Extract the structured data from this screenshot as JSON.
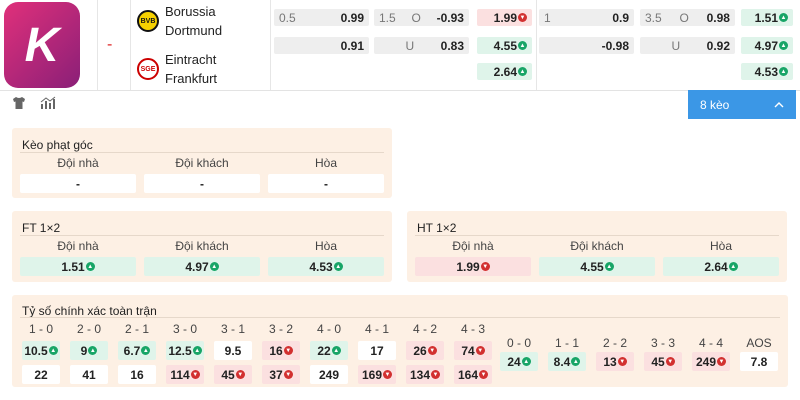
{
  "logo": {
    "letter": "K"
  },
  "match": {
    "dash": "-",
    "home": {
      "name1": "Borussia",
      "name2": "Dortmund",
      "crest": "BVB"
    },
    "away": {
      "name1": "Eintracht",
      "name2": "Frankfurt",
      "crest": "SGE"
    }
  },
  "odds": {
    "r1": [
      {
        "a": "0.5",
        "b": "0.99",
        "t": "n"
      },
      {
        "a": "1.5",
        "m": "O",
        "b": "-0.93",
        "t": "n"
      },
      {
        "b": "1.99",
        "t": "dn"
      },
      {
        "a": "1",
        "b": "0.9",
        "t": "n"
      },
      {
        "a": "3.5",
        "m": "O",
        "b": "0.98",
        "t": "n"
      },
      {
        "b": "1.51",
        "t": "up"
      }
    ],
    "r2": [
      {
        "a": "",
        "b": "0.91",
        "t": "n"
      },
      {
        "a": "",
        "m": "U",
        "b": "0.83",
        "t": "n"
      },
      {
        "b": "4.55",
        "t": "up"
      },
      {
        "a": "",
        "b": "-0.98",
        "t": "n"
      },
      {
        "a": "",
        "m": "U",
        "b": "0.92",
        "t": "n"
      },
      {
        "b": "4.97",
        "t": "up"
      }
    ],
    "r3": [
      {
        "b": "2.64",
        "t": "up"
      },
      {
        "b": "4.53",
        "t": "up"
      }
    ]
  },
  "toolbar": {
    "shirt_icon": "shirt-icon",
    "stats_icon": "stats-icon",
    "more_label": "8 kèo"
  },
  "corner": {
    "title": "Kèo phạt góc",
    "headers": [
      "Đội nhà",
      "Đội khách",
      "Hòa"
    ],
    "values": [
      "-",
      "-",
      "-"
    ]
  },
  "ft": {
    "title": "FT 1×2",
    "headers": [
      "Đội nhà",
      "Đội khách",
      "Hòa"
    ],
    "values": [
      {
        "v": "1.51",
        "t": "up"
      },
      {
        "v": "4.97",
        "t": "up"
      },
      {
        "v": "4.53",
        "t": "up"
      }
    ]
  },
  "ht": {
    "title": "HT 1×2",
    "headers": [
      "Đội nhà",
      "Đội khách",
      "Hòa"
    ],
    "values": [
      {
        "v": "1.99",
        "t": "dn"
      },
      {
        "v": "4.55",
        "t": "up"
      },
      {
        "v": "2.64",
        "t": "up"
      }
    ]
  },
  "exact": {
    "title": "Tỷ số chính xác toàn trận",
    "home_scores": [
      "1 - 0",
      "2 - 0",
      "2 - 1",
      "3 - 0",
      "3 - 1",
      "3 - 2",
      "4 - 0",
      "4 - 1",
      "4 - 2",
      "4 - 3"
    ],
    "home_row1": [
      {
        "v": "10.5",
        "t": "up"
      },
      {
        "v": "9",
        "t": "up"
      },
      {
        "v": "6.7",
        "t": "up"
      },
      {
        "v": "12.5",
        "t": "up"
      },
      {
        "v": "9.5",
        "t": "n"
      },
      {
        "v": "16",
        "t": "dn"
      },
      {
        "v": "22",
        "t": "up"
      },
      {
        "v": "17",
        "t": "n"
      },
      {
        "v": "26",
        "t": "dn"
      },
      {
        "v": "74",
        "t": "dn"
      }
    ],
    "home_row2": [
      {
        "v": "22",
        "t": "n"
      },
      {
        "v": "41",
        "t": "n"
      },
      {
        "v": "16",
        "t": "n"
      },
      {
        "v": "114",
        "t": "dn"
      },
      {
        "v": "45",
        "t": "dn"
      },
      {
        "v": "37",
        "t": "dn"
      },
      {
        "v": "249",
        "t": "n"
      },
      {
        "v": "169",
        "t": "dn"
      },
      {
        "v": "134",
        "t": "dn"
      },
      {
        "v": "164",
        "t": "dn"
      }
    ],
    "draw_scores": [
      "0 - 0",
      "1 - 1",
      "2 - 2",
      "3 - 3",
      "4 - 4",
      "AOS"
    ],
    "draw_row": [
      {
        "v": "24",
        "t": "up"
      },
      {
        "v": "8.4",
        "t": "up"
      },
      {
        "v": "13",
        "t": "dn"
      },
      {
        "v": "45",
        "t": "dn"
      },
      {
        "v": "249",
        "t": "dn"
      },
      {
        "v": "7.8",
        "t": "n"
      }
    ]
  }
}
